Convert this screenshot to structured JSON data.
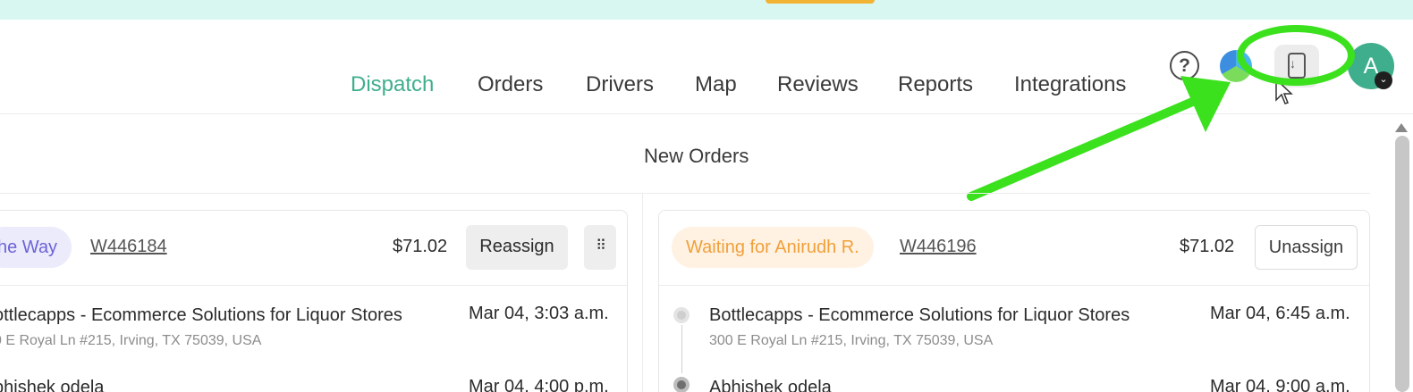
{
  "nav": {
    "links": [
      {
        "label": "Dispatch",
        "active": true
      },
      {
        "label": "Orders",
        "active": false
      },
      {
        "label": "Drivers",
        "active": false
      },
      {
        "label": "Map",
        "active": false
      },
      {
        "label": "Reviews",
        "active": false
      },
      {
        "label": "Reports",
        "active": false
      },
      {
        "label": "Integrations",
        "active": false
      }
    ],
    "help_glyph": "?",
    "avatar_initial": "A",
    "avatar_chevron": "⌄",
    "icons": {
      "help": "help-circle-icon",
      "language": "globe-icon",
      "install": "install-app-icon",
      "avatar_menu": "chevron-down-icon"
    }
  },
  "section": {
    "title": "New Orders"
  },
  "orders": [
    {
      "status": "he Way",
      "order_id": "W446184",
      "price": "$71.02",
      "action": "Reassign",
      "grip_glyph": "⠿",
      "stops": [
        {
          "title": "ottlecapps - Ecommerce Solutions for Liquor Stores",
          "address": "0 E Royal Ln #215, Irving, TX 75039, USA",
          "time": "Mar 04, 3:03 a.m."
        },
        {
          "title": "bhishek odela",
          "address": "",
          "time": "Mar 04, 4:00 p.m."
        }
      ]
    },
    {
      "status": "Waiting for Anirudh R.",
      "order_id": "W446196",
      "price": "$71.02",
      "action": "Unassign",
      "stops": [
        {
          "title": "Bottlecapps - Ecommerce Solutions for Liquor Stores",
          "address": "300 E Royal Ln #215, Irving, TX 75039, USA",
          "time": "Mar 04, 6:45 a.m."
        },
        {
          "title": "Abhishek odela",
          "address": "",
          "time": "Mar 04, 9:00 a.m."
        }
      ]
    }
  ],
  "colors": {
    "brand_green": "#3fae8c",
    "annotation_green": "#3be11d",
    "status_blue": "#6c63d6",
    "status_orange": "#f0a03a",
    "banner_bg": "#d9f7f1"
  }
}
